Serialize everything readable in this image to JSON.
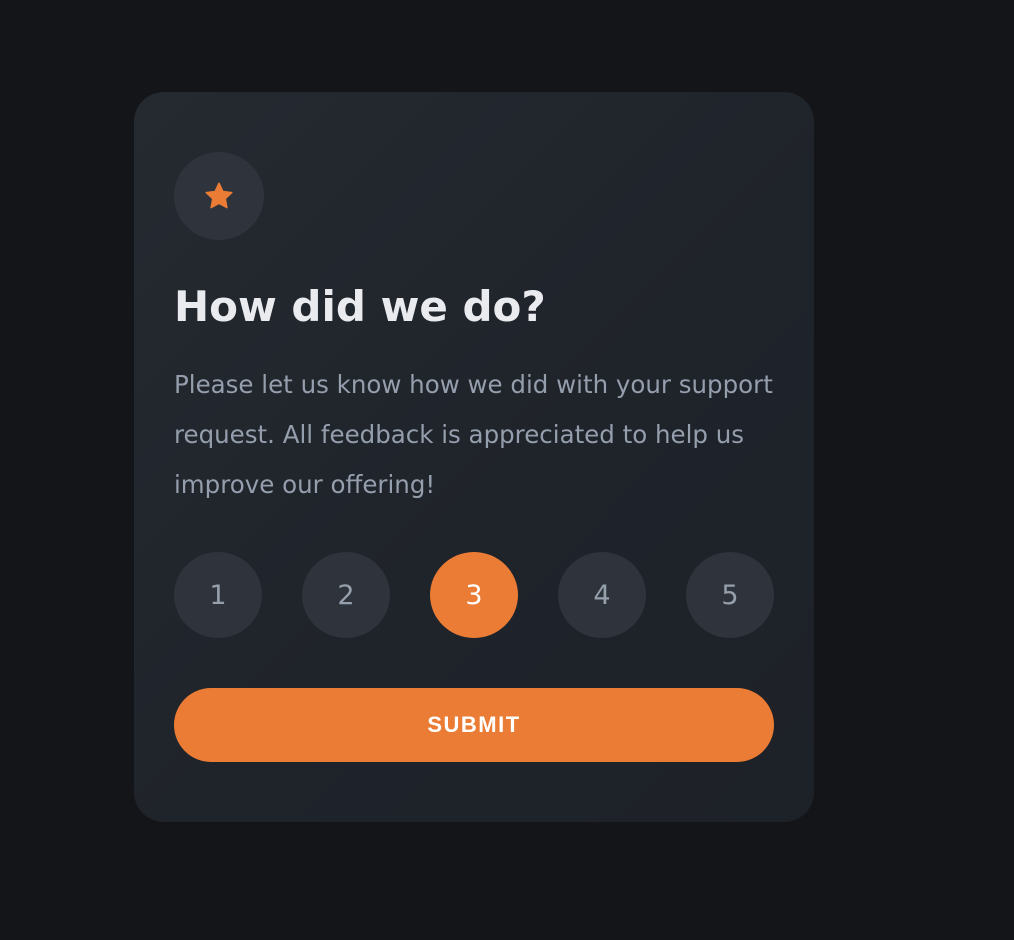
{
  "card": {
    "icon": "star-icon",
    "title": "How did we do?",
    "description": "Please let us know how we did with your support request. All feedback is appreciated to help us improve our offering!"
  },
  "ratings": [
    {
      "label": "1",
      "selected": false
    },
    {
      "label": "2",
      "selected": false
    },
    {
      "label": "3",
      "selected": true
    },
    {
      "label": "4",
      "selected": false
    },
    {
      "label": "5",
      "selected": false
    }
  ],
  "selected_rating": 3,
  "submit_label": "SUBMIT",
  "colors": {
    "page_background": "#131518",
    "card_background": "#22262d",
    "accent": "#eb7c35",
    "circle_background": "#2f343c",
    "title_text": "#e9ebee",
    "body_text": "#959eac"
  }
}
